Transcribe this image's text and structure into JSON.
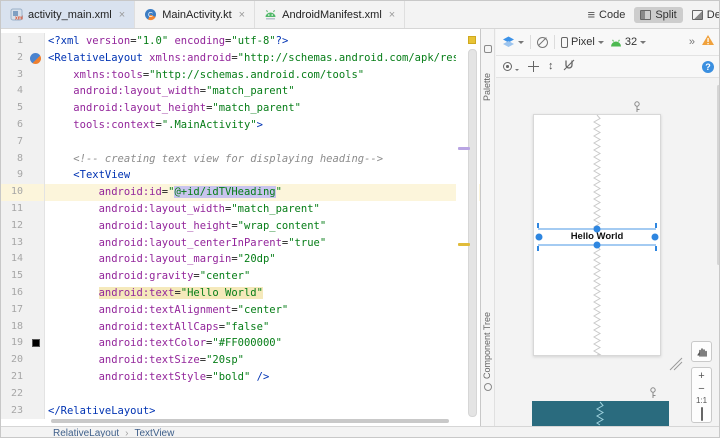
{
  "tabs": [
    {
      "label": "activity_main.xml",
      "icon": "layout-xml-file-icon",
      "selected": true
    },
    {
      "label": "MainActivity.kt",
      "icon": "kotlin-file-icon",
      "selected": false
    },
    {
      "label": "AndroidManifest.xml",
      "icon": "android-manifest-icon",
      "selected": false
    }
  ],
  "ui": {
    "close_glyph": "×",
    "overflow_glyph": "»",
    "breadcrumb_separator": "›",
    "vertical_arrows_glyph": "↕",
    "code_icon_glyph": "≡"
  },
  "view_modes": {
    "code": {
      "label": "Code",
      "selected": false
    },
    "split": {
      "label": "Split",
      "selected": true
    },
    "design": {
      "label": "Design",
      "selected": false
    }
  },
  "editor": {
    "lines": [
      {
        "n": 1,
        "tokens": [
          [
            "t",
            "<?xml "
          ],
          [
            "a",
            "version"
          ],
          [
            "p",
            "="
          ],
          [
            "v",
            "\"1.0\""
          ],
          [
            "p",
            " "
          ],
          [
            "a",
            "encoding"
          ],
          [
            "p",
            "="
          ],
          [
            "v",
            "\"utf-8\""
          ],
          [
            "t",
            "?>"
          ]
        ]
      },
      {
        "n": 2,
        "gutter": "kotlin",
        "tokens": [
          [
            "t",
            "<RelativeLayout"
          ],
          [
            "p",
            " "
          ],
          [
            "a",
            "xmlns:android"
          ],
          [
            "p",
            "="
          ],
          [
            "v",
            "\"http://schemas.android.com/apk/res/"
          ]
        ]
      },
      {
        "n": 3,
        "tokens": [
          [
            "p",
            "    "
          ],
          [
            "a",
            "xmlns:tools"
          ],
          [
            "p",
            "="
          ],
          [
            "v",
            "\"http://schemas.android.com/tools\""
          ]
        ]
      },
      {
        "n": 4,
        "tokens": [
          [
            "p",
            "    "
          ],
          [
            "a",
            "android:layout_width"
          ],
          [
            "p",
            "="
          ],
          [
            "v",
            "\"match_parent\""
          ]
        ]
      },
      {
        "n": 5,
        "tokens": [
          [
            "p",
            "    "
          ],
          [
            "a",
            "android:layout_height"
          ],
          [
            "p",
            "="
          ],
          [
            "v",
            "\"match_parent\""
          ]
        ]
      },
      {
        "n": 6,
        "tokens": [
          [
            "p",
            "    "
          ],
          [
            "a",
            "tools:context"
          ],
          [
            "p",
            "="
          ],
          [
            "v",
            "\".MainActivity\""
          ],
          [
            "t",
            ">"
          ]
        ]
      },
      {
        "n": 7,
        "tokens": []
      },
      {
        "n": 8,
        "tokens": [
          [
            "p",
            "    "
          ],
          [
            "c",
            "<!-- creating text view for displaying heading-->"
          ]
        ]
      },
      {
        "n": 9,
        "tokens": [
          [
            "p",
            "    "
          ],
          [
            "t",
            "<TextView"
          ]
        ]
      },
      {
        "n": 10,
        "caret": true,
        "tokens": [
          [
            "p",
            "        "
          ],
          [
            "a",
            "android:id"
          ],
          [
            "p",
            "="
          ],
          [
            "v",
            "\""
          ],
          [
            "v",
            "@+id/idTVHeading",
            "sel"
          ],
          [
            "v",
            "\""
          ]
        ]
      },
      {
        "n": 11,
        "tokens": [
          [
            "p",
            "        "
          ],
          [
            "a",
            "android:layout_width"
          ],
          [
            "p",
            "="
          ],
          [
            "v",
            "\"match_parent\""
          ]
        ]
      },
      {
        "n": 12,
        "tokens": [
          [
            "p",
            "        "
          ],
          [
            "a",
            "android:layout_height"
          ],
          [
            "p",
            "="
          ],
          [
            "v",
            "\"wrap_content\""
          ]
        ]
      },
      {
        "n": 13,
        "tokens": [
          [
            "p",
            "        "
          ],
          [
            "a",
            "android:layout_centerInParent"
          ],
          [
            "p",
            "="
          ],
          [
            "v",
            "\"true\""
          ]
        ]
      },
      {
        "n": 14,
        "tokens": [
          [
            "p",
            "        "
          ],
          [
            "a",
            "android:layout_margin"
          ],
          [
            "p",
            "="
          ],
          [
            "v",
            "\"20dp\""
          ]
        ]
      },
      {
        "n": 15,
        "tokens": [
          [
            "p",
            "        "
          ],
          [
            "a",
            "android:gravity"
          ],
          [
            "p",
            "="
          ],
          [
            "v",
            "\"center\""
          ]
        ]
      },
      {
        "n": 16,
        "tokens": [
          [
            "p",
            "        "
          ],
          [
            "a",
            "android:text",
            "use"
          ],
          [
            "p",
            "=",
            "use"
          ],
          [
            "v",
            "\"Hello World\"",
            "use"
          ]
        ]
      },
      {
        "n": 17,
        "tokens": [
          [
            "p",
            "        "
          ],
          [
            "a",
            "android:textAlignment"
          ],
          [
            "p",
            "="
          ],
          [
            "v",
            "\"center\""
          ]
        ]
      },
      {
        "n": 18,
        "tokens": [
          [
            "p",
            "        "
          ],
          [
            "a",
            "android:textAllCaps"
          ],
          [
            "p",
            "="
          ],
          [
            "v",
            "\"false\""
          ]
        ]
      },
      {
        "n": 19,
        "gutter": "swatch",
        "tokens": [
          [
            "p",
            "        "
          ],
          [
            "a",
            "android:textColor"
          ],
          [
            "p",
            "="
          ],
          [
            "v",
            "\"#FF000000\""
          ]
        ]
      },
      {
        "n": 20,
        "tokens": [
          [
            "p",
            "        "
          ],
          [
            "a",
            "android:textSize"
          ],
          [
            "p",
            "="
          ],
          [
            "v",
            "\"20sp\""
          ]
        ]
      },
      {
        "n": 21,
        "tokens": [
          [
            "p",
            "        "
          ],
          [
            "a",
            "android:textStyle"
          ],
          [
            "p",
            "="
          ],
          [
            "v",
            "\"bold\""
          ],
          [
            "p",
            " "
          ],
          [
            "t",
            "/>"
          ]
        ]
      },
      {
        "n": 22,
        "tokens": []
      },
      {
        "n": 23,
        "tokens": [
          [
            "t",
            "</RelativeLayout>"
          ]
        ]
      }
    ],
    "breadcrumb": {
      "items": [
        "RelativeLayout",
        "TextView"
      ]
    }
  },
  "design": {
    "palette_label": "Palette",
    "component_tree_label": "Component Tree",
    "toolbar": {
      "device": "Pixel",
      "api_level": "32",
      "warning_glyph": "!",
      "help_glyph": "?"
    },
    "preview_text": "Hello World",
    "zoom": {
      "zoom_in": "+",
      "zoom_out": "−",
      "actual_size": "1:1"
    }
  },
  "colors": {
    "selection_blue": "#2e86e0",
    "blueprint_teal": "#2a6b7e",
    "warning_orange": "#f0a13c",
    "caret_row": "#fcf5db",
    "usage_highlight": "#f5e9bb",
    "identifier_selection": "#c9c4ee",
    "tag_blue": "#0033b3",
    "attribute_purple": "#93259b",
    "value_green": "#067d17",
    "selected_tab": "#d9e2ef"
  }
}
